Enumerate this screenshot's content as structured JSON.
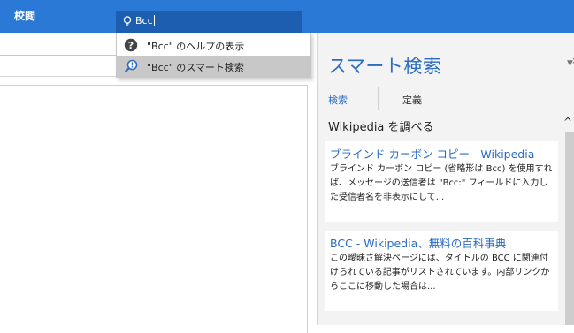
{
  "ribbon": {
    "tab_label": "校閲",
    "accent_color": "#2b79d6",
    "search": {
      "icon": "lightbulb-icon",
      "value": "Bcc"
    }
  },
  "dropdown": {
    "items": [
      {
        "icon": "help-icon",
        "label": "\"Bcc\" のヘルプの表示"
      },
      {
        "icon": "smart-lookup-icon",
        "label": "\"Bcc\" のスマート検索"
      }
    ]
  },
  "pane": {
    "title": "スマート検索",
    "tabs": {
      "search": "検索",
      "define": "定義"
    },
    "section_heading": "Wikipedia を調べる",
    "results": [
      {
        "title": "ブラインド カーボン コピー - Wikipedia",
        "snippet": "ブラインド カーボン コピー (省略形は Bcc) を使用すれば、メッセージの送信者は \"Bcc:\" フィールドに入力した受信者名を非表示にして..."
      },
      {
        "title": "BCC - Wikipedia、無料の百科事典",
        "snippet": "この曖昧さ解決ページには、タイトルの BCC に関連付けられている記事がリストされています。内部リンクからここに移動した場合は..."
      }
    ]
  }
}
